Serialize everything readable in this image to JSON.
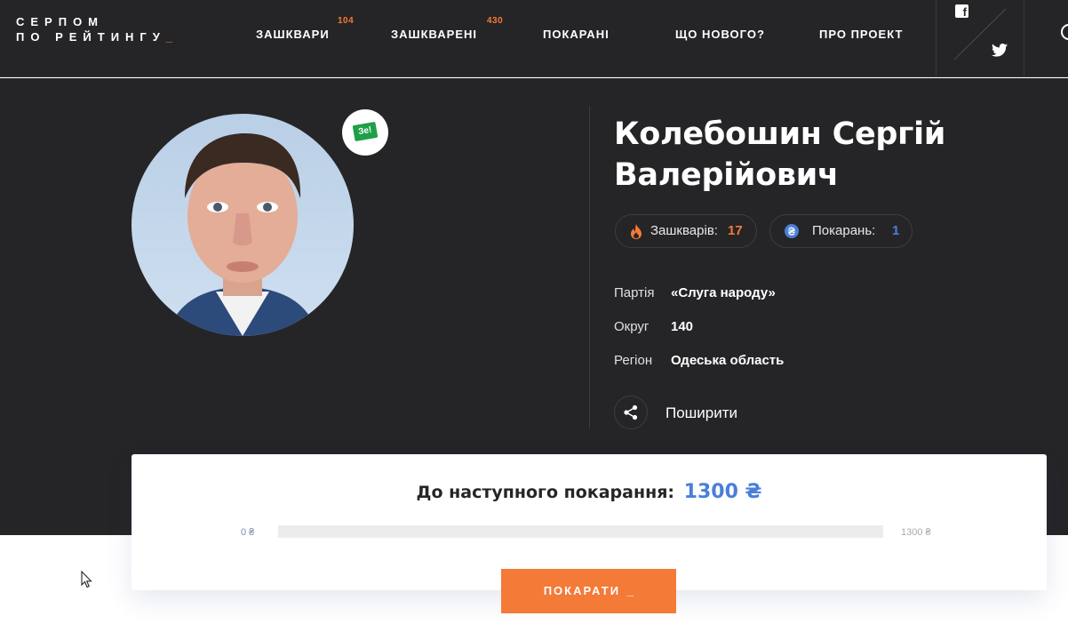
{
  "header": {
    "logo_line1": "СЕРПОМ",
    "logo_line2": "ПО РЕЙТИНГУ",
    "logo_cursor": "_",
    "nav": [
      {
        "label": "ЗАШКВАРИ",
        "badge": "104"
      },
      {
        "label": "ЗАШКВАРЕНІ",
        "badge": "430"
      },
      {
        "label": "ПОКАРАНІ"
      },
      {
        "label": "ЩО НОВОГО?"
      },
      {
        "label": "ПРО ПРОЕКТ"
      }
    ],
    "social": {
      "facebook_icon": "facebook-icon",
      "twitter_icon": "twitter-icon"
    },
    "search_icon": "search-icon"
  },
  "profile": {
    "name": "Колебошин Сергій Валерійович",
    "party_badge": "Зе!",
    "stats": {
      "zashkvary_label": "Зашкварів:",
      "zashkvary_count": "17",
      "punishments_label": "Покарань:",
      "punishments_count": "1"
    },
    "info": {
      "party_label": "Партія",
      "party_value": "«Слуга народу»",
      "district_label": "Округ",
      "district_value": "140",
      "region_label": "Регіон",
      "region_value": "Одеська область"
    },
    "share_label": "Поширити"
  },
  "punishment_card": {
    "title": "До наступного покарання:",
    "amount": "1300 ₴",
    "range_min": "0 ₴",
    "range_max": "1300 ₴",
    "progress": 0,
    "button_label": "ПОКАРАТИ",
    "button_cursor": "_"
  },
  "colors": {
    "accent": "#f47a38",
    "blue": "#4a7fd8",
    "dark_bg": "#252527",
    "party_green": "#1fa047"
  }
}
